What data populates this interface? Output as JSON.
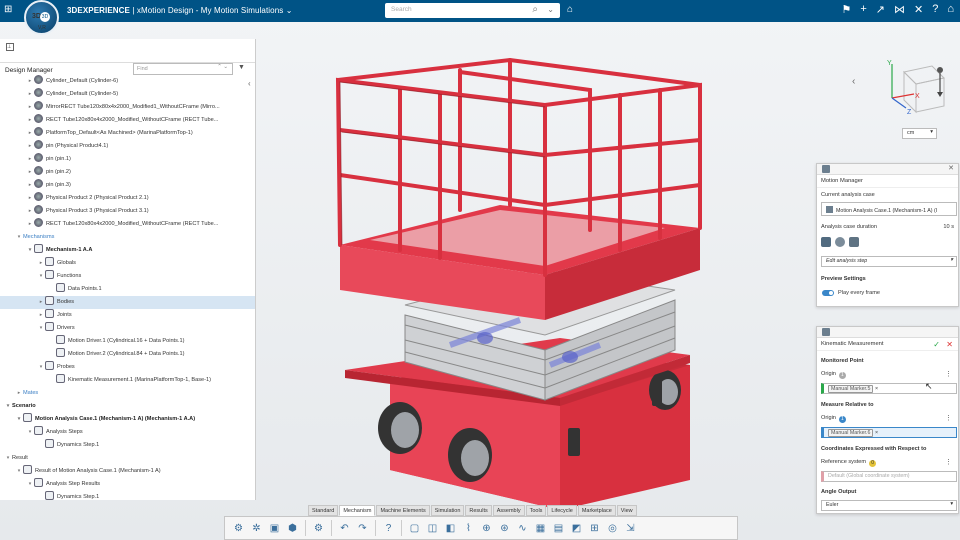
{
  "topbar": {
    "logo_ds": "3DS",
    "logo_center": "3D",
    "logo_version": "V,R",
    "app_name": "3DEXPERIENCE",
    "separator": "|",
    "context": "xMotion Design - My Motion Simulations",
    "search_placeholder": "Search",
    "right_icons": [
      "bookmark-icon",
      "add-icon",
      "share-icon",
      "network-icon",
      "tools-icon",
      "help-icon",
      "home-icon"
    ]
  },
  "left_panel": {
    "title": "Design Manager",
    "find_placeholder": "Find",
    "tree": [
      {
        "label": "Cylinder_Default (Cylinder-6)",
        "indent": 1,
        "icon": "part",
        "tw": "▸"
      },
      {
        "label": "Cylinder_Default (Cylinder-5)",
        "indent": 1,
        "icon": "part",
        "tw": "▸"
      },
      {
        "label": "MirrorRECT Tube120x80x4x2000_Modified1_WithoutCFrame (Mirro...",
        "indent": 1,
        "icon": "part",
        "tw": "▸"
      },
      {
        "label": "RECT Tube120x80x4x2000_Modified_WithoutCFrame (RECT Tube...",
        "indent": 1,
        "icon": "part",
        "tw": "▸"
      },
      {
        "label": "PlatformTop_Default<As Machined> (MarinaPlatformTop-1)",
        "indent": 1,
        "icon": "part",
        "tw": "▸"
      },
      {
        "label": "pin (Physical Product4.1)",
        "indent": 1,
        "icon": "part",
        "tw": "▸"
      },
      {
        "label": "pin (pin.1)",
        "indent": 1,
        "icon": "part",
        "tw": "▸"
      },
      {
        "label": "pin (pin.2)",
        "indent": 1,
        "icon": "part",
        "tw": "▸"
      },
      {
        "label": "pin (pin.3)",
        "indent": 1,
        "icon": "part",
        "tw": "▸"
      },
      {
        "label": "Physical Product 2 (Physical Product 2.1)",
        "indent": 1,
        "icon": "part",
        "tw": "▸"
      },
      {
        "label": "Physical Product 3 (Physical Product 3.1)",
        "indent": 1,
        "icon": "part",
        "tw": "▸"
      },
      {
        "label": "RECT Tube120x80x4x2000_Modified_WithoutCFrame (RECT Tube...",
        "indent": 1,
        "icon": "part",
        "tw": "▸"
      },
      {
        "label": "Mechanisms",
        "indent": 0,
        "style": "blue",
        "tw": "▾"
      },
      {
        "label": "Mechanism-1 A.A",
        "indent": 1,
        "style": "bold",
        "icon": "box",
        "tw": "▾"
      },
      {
        "label": "Globals",
        "indent": 2,
        "icon": "box",
        "tw": "▸"
      },
      {
        "label": "Functions",
        "indent": 2,
        "icon": "box",
        "tw": "▾"
      },
      {
        "label": "Data Points.1",
        "indent": 3,
        "icon": "box",
        "tw": ""
      },
      {
        "label": "Bodies",
        "indent": 2,
        "icon": "box",
        "tw": "▸",
        "selected": true
      },
      {
        "label": "Joints",
        "indent": 2,
        "icon": "box",
        "tw": "▸"
      },
      {
        "label": "Drivers",
        "indent": 2,
        "icon": "box",
        "tw": "▾"
      },
      {
        "label": "Motion Driver.1 (Cylindrical.16 + Data Points.1)",
        "indent": 3,
        "icon": "box",
        "tw": ""
      },
      {
        "label": "Motion Driver.2 (Cylindrical.84 + Data Points.1)",
        "indent": 3,
        "icon": "box",
        "tw": ""
      },
      {
        "label": "Probes",
        "indent": 2,
        "icon": "box",
        "tw": "▾"
      },
      {
        "label": "Kinematic Measurement.1 (MarinaPlatformTop-1, Base-1)",
        "indent": 3,
        "icon": "box",
        "tw": ""
      },
      {
        "label": "Mates",
        "indent": 0,
        "style": "blue",
        "tw": "▸"
      },
      {
        "label": "Scenario",
        "indent": -1,
        "style": "bold",
        "tw": "▾"
      },
      {
        "label": "Motion Analysis Case.1 (Mechanism-1 A) (Mechanism-1 A.A)",
        "indent": 0,
        "style": "bold",
        "icon": "box",
        "tw": "▾"
      },
      {
        "label": "Analysis Steps",
        "indent": 1,
        "icon": "box",
        "tw": "▾"
      },
      {
        "label": "Dynamics Step.1",
        "indent": 2,
        "icon": "box",
        "tw": ""
      },
      {
        "label": "Result",
        "indent": -1,
        "tw": "▾"
      },
      {
        "label": "Result of Motion Analysis Case.1 (Mechanism-1 A)",
        "indent": 0,
        "icon": "box",
        "tw": "▾"
      },
      {
        "label": "Analysis Step Results",
        "indent": 1,
        "icon": "box",
        "tw": "▾"
      },
      {
        "label": "Dynamics Step.1",
        "indent": 2,
        "icon": "box",
        "tw": ""
      }
    ]
  },
  "viewport": {
    "units": "cm",
    "axis_y": "Y",
    "axis_x": "X",
    "axis_z": "Z"
  },
  "motion_manager": {
    "title": "Motion Manager",
    "current_label": "Current analysis case",
    "current_value": "Motion Analysis Case.1 (Mechanism-1 A) (I",
    "duration_label": "Analysis case duration",
    "duration_value": "10 s",
    "edit_step": "Edit analysis step",
    "preview_label": "Preview Settings",
    "play_every_frame": "Play every frame"
  },
  "kinematic": {
    "title": "Kinematic Measurement",
    "monitored_point": "Monitored Point",
    "origin_label": "Origin",
    "origin_badge": "1",
    "origin_value": "Manual Marker.5",
    "measure_relative": "Measure Relative to",
    "origin2_label": "Origin",
    "origin2_badge": "1",
    "origin2_value": "Manual Marker.6",
    "coords_label": "Coordinates Expressed with Respect to",
    "ref_label": "Reference system",
    "ref_badge": "0",
    "ref_value": "Default (Global coordinate system)",
    "angle_label": "Angle Output",
    "angle_value": "Euler"
  },
  "tabs": [
    "Standard",
    "Mechanism",
    "Machine Elements",
    "Simulation",
    "Results",
    "Assembly",
    "Tools",
    "Lifecycle",
    "Marketplace",
    "View"
  ],
  "active_tab": "Mechanism",
  "toolbar_icons": [
    "gear-icon",
    "gear-alt-icon",
    "save-icon",
    "cube-gear-icon",
    "sep",
    "settings-icon",
    "sep",
    "undo-icon",
    "redo-icon",
    "sep",
    "help-icon",
    "sep",
    "cube-icon",
    "box-icon",
    "plane-icon",
    "spring-icon",
    "joint-icon",
    "motor-icon",
    "wave-icon",
    "grid-icon",
    "chart-icon",
    "view-icon",
    "measure-icon",
    "sensor-icon",
    "export-icon"
  ],
  "colors": {
    "brand": "#005386",
    "accent": "#3a87c9",
    "lift_red": "#e03a4b",
    "panel_border": "#c8c8c8"
  }
}
